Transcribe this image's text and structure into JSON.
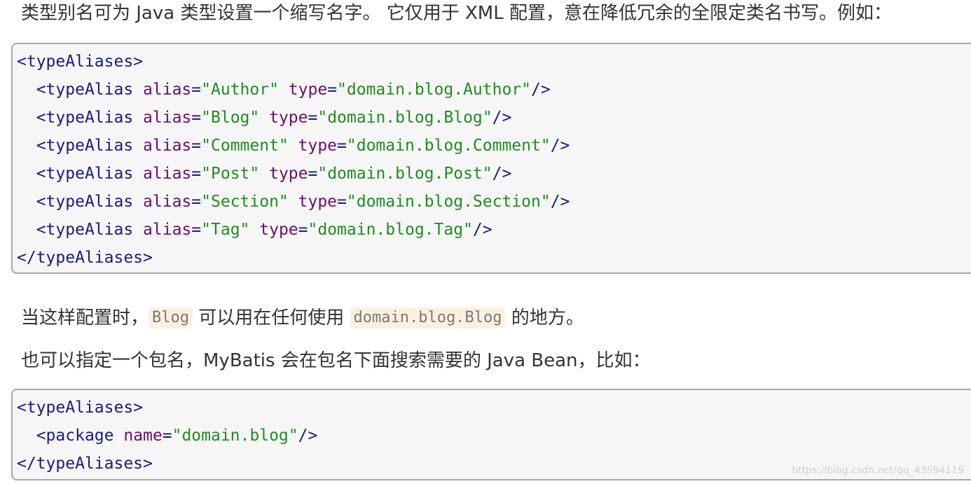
{
  "intro_text": "类型别名可为 Java 类型设置一个缩写名字。 它仅用于 XML 配置，意在降低冗余的全限定类名书写。例如：",
  "code_block_1": {
    "lines": [
      {
        "indent": "",
        "tag_open": "<typeAliases>",
        "attrs": [],
        "tag_close": ""
      },
      {
        "indent": "  ",
        "tag_open": "<typeAlias",
        "attrs": [
          {
            "name": "alias",
            "value": "\"Author\""
          },
          {
            "name": "type",
            "value": "\"domain.blog.Author\""
          }
        ],
        "tag_close": "/>"
      },
      {
        "indent": "  ",
        "tag_open": "<typeAlias",
        "attrs": [
          {
            "name": "alias",
            "value": "\"Blog\""
          },
          {
            "name": "type",
            "value": "\"domain.blog.Blog\""
          }
        ],
        "tag_close": "/>"
      },
      {
        "indent": "  ",
        "tag_open": "<typeAlias",
        "attrs": [
          {
            "name": "alias",
            "value": "\"Comment\""
          },
          {
            "name": "type",
            "value": "\"domain.blog.Comment\""
          }
        ],
        "tag_close": "/>"
      },
      {
        "indent": "  ",
        "tag_open": "<typeAlias",
        "attrs": [
          {
            "name": "alias",
            "value": "\"Post\""
          },
          {
            "name": "type",
            "value": "\"domain.blog.Post\""
          }
        ],
        "tag_close": "/>"
      },
      {
        "indent": "  ",
        "tag_open": "<typeAlias",
        "attrs": [
          {
            "name": "alias",
            "value": "\"Section\""
          },
          {
            "name": "type",
            "value": "\"domain.blog.Section\""
          }
        ],
        "tag_close": "/>"
      },
      {
        "indent": "  ",
        "tag_open": "<typeAlias",
        "attrs": [
          {
            "name": "alias",
            "value": "\"Tag\""
          },
          {
            "name": "type",
            "value": "\"domain.blog.Tag\""
          }
        ],
        "tag_close": "/>"
      },
      {
        "indent": "",
        "tag_open": "</typeAliases>",
        "attrs": [],
        "tag_close": ""
      }
    ]
  },
  "para_2": {
    "before": "当这样配置时，",
    "code_1": "Blog",
    "middle": " 可以用在任何使用 ",
    "code_2": "domain.blog.Blog",
    "after": " 的地方。"
  },
  "para_3": "也可以指定一个包名，MyBatis 会在包名下面搜索需要的 Java Bean，比如：",
  "code_block_2": {
    "lines": [
      {
        "indent": "",
        "tag_open": "<typeAliases>",
        "attrs": [],
        "tag_close": ""
      },
      {
        "indent": "  ",
        "tag_open": "<package",
        "attrs": [
          {
            "name": "name",
            "value": "\"domain.blog\""
          }
        ],
        "tag_close": "/>"
      },
      {
        "indent": "",
        "tag_open": "</typeAliases>",
        "attrs": [],
        "tag_close": ""
      }
    ]
  },
  "watermark": "https://blog.csdn.net/qq_43594119",
  "colors": {
    "tag": "#1a1a80",
    "attribute": "#6c0e6e",
    "string": "#228b22",
    "code_background": "#f6f6f6",
    "inline_code_background": "#fbf0e0"
  }
}
